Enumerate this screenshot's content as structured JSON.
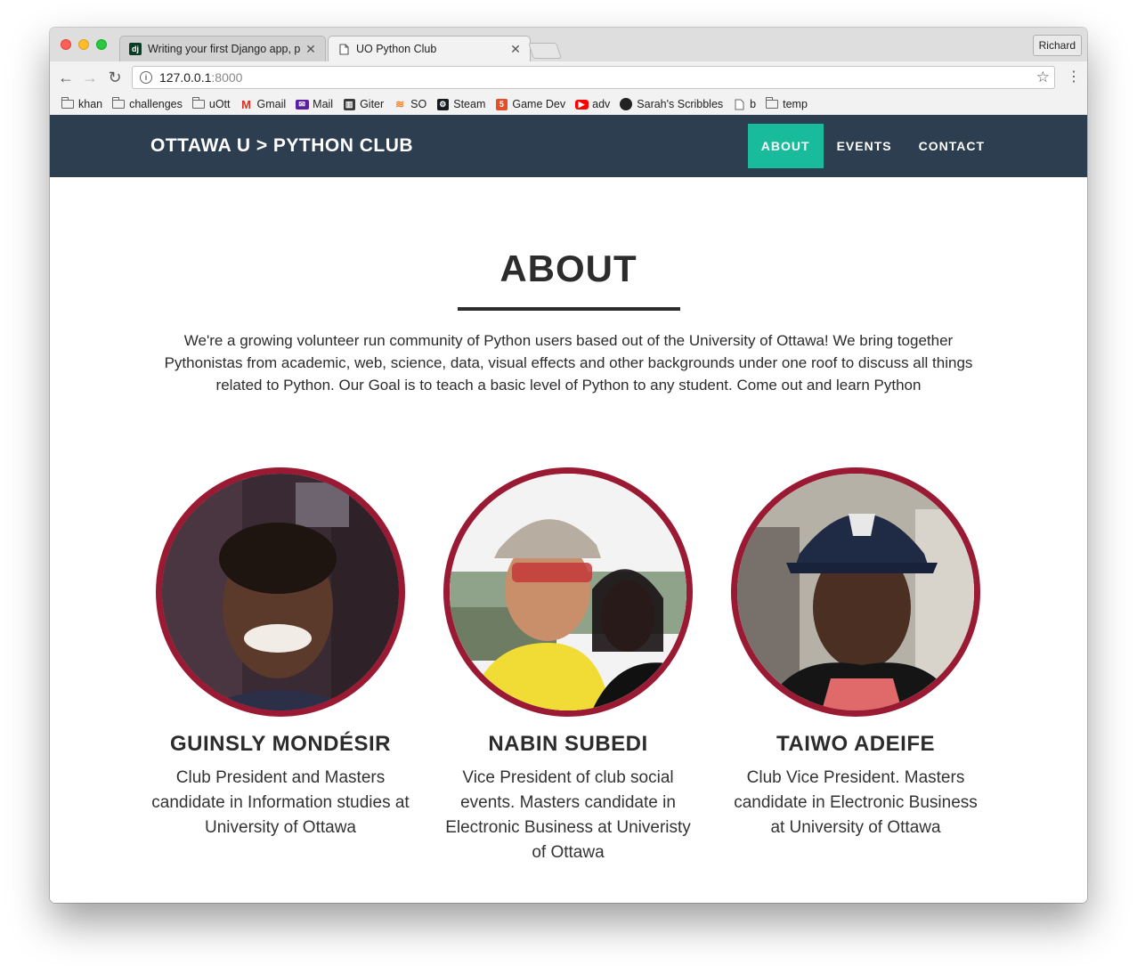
{
  "browser": {
    "tabs": [
      {
        "title": "Writing your first Django app, p",
        "favicon": "django-icon",
        "active": false
      },
      {
        "title": "UO Python Club",
        "favicon": "page-icon",
        "active": true
      }
    ],
    "profile": "Richard",
    "url_host": "127.0.0.1",
    "url_port": ":8000",
    "bookmarks": [
      {
        "label": "khan",
        "icon": "folder-icon"
      },
      {
        "label": "challenges",
        "icon": "folder-icon"
      },
      {
        "label": "uOtt",
        "icon": "folder-icon"
      },
      {
        "label": "Gmail",
        "icon": "gmail-icon"
      },
      {
        "label": "Mail",
        "icon": "mail-icon"
      },
      {
        "label": "Giter",
        "icon": "giter-icon"
      },
      {
        "label": "SO",
        "icon": "stackoverflow-icon"
      },
      {
        "label": "Steam",
        "icon": "steam-icon"
      },
      {
        "label": "Game Dev",
        "icon": "html5-icon"
      },
      {
        "label": "adv",
        "icon": "youtube-icon"
      },
      {
        "label": "Sarah's Scribbles",
        "icon": "scribbles-icon"
      },
      {
        "label": "b",
        "icon": "page-icon"
      },
      {
        "label": "temp",
        "icon": "folder-icon"
      }
    ]
  },
  "site": {
    "brand": "OTTAWA U > PYTHON CLUB",
    "nav": [
      {
        "label": "ABOUT",
        "active": true
      },
      {
        "label": "EVENTS",
        "active": false
      },
      {
        "label": "CONTACT",
        "active": false
      }
    ],
    "about": {
      "title": "ABOUT",
      "intro": "We're a growing volunteer run community of Python users based out of the University of Ottawa! We bring together Pythonistas from academic, web, science, data, visual effects and other backgrounds under one roof to discuss all things related to Python. Our Goal is to teach a basic level of Python to any student. Come out and learn Python"
    },
    "members": [
      {
        "name": "GUINSLY MONDÉSIR",
        "description": "Club President and Masters candidate in Information studies at University of Ottawa"
      },
      {
        "name": "NABIN SUBEDI",
        "description": "Vice President of club social events. Masters candidate in Electronic Business at Univeristy of Ottawa"
      },
      {
        "name": "TAIWO ADEIFE",
        "description": "Club Vice President. Masters candidate in Electronic Business at University of Ottawa"
      }
    ]
  },
  "colors": {
    "navbar": "#2c3e50",
    "accent": "#18bc9c",
    "avatar_border": "#9b1a33",
    "text": "#2c2c2c"
  }
}
